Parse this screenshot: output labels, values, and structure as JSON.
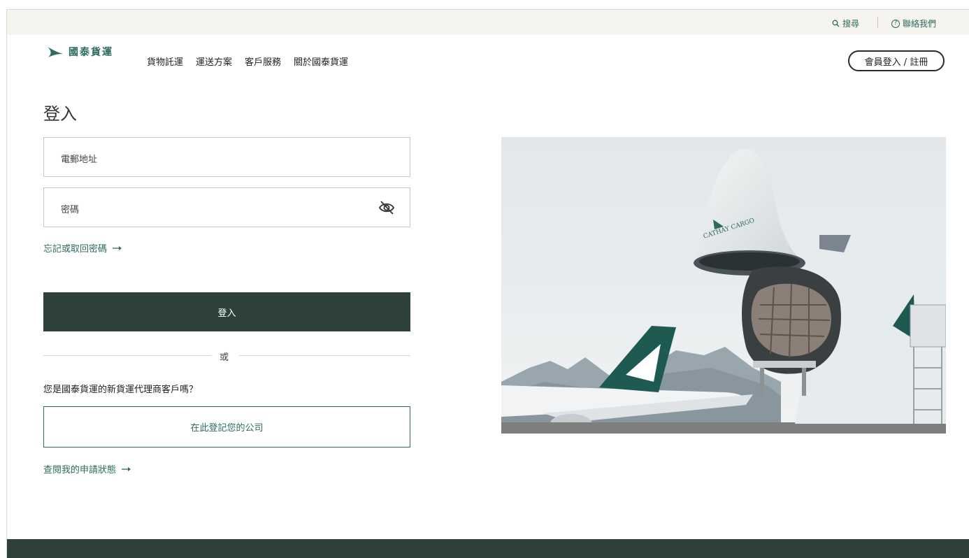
{
  "utility": {
    "search_label": "搜尋",
    "contact_label": "聯絡我們"
  },
  "header": {
    "logo_text": "國泰貨運",
    "nav": [
      {
        "label": "貨物託運"
      },
      {
        "label": "運送方案"
      },
      {
        "label": "客戶服務"
      },
      {
        "label": "關於國泰貨運"
      }
    ],
    "login_register_label": "會員登入 / 註冊"
  },
  "login": {
    "title": "登入",
    "email_placeholder": "電郵地址",
    "password_placeholder": "密碼",
    "forgot_link": "忘記或取回密碼",
    "submit_label": "登入",
    "divider_text": "或",
    "agent_question": "您是國泰貨運的新貨運代理商客戶嗎？",
    "register_label": "在此登記您的公司",
    "status_link": "查閱我的申請狀態"
  },
  "hero": {
    "aircraft_text": "CATHAY CARGO"
  },
  "colors": {
    "brand_green": "#2d6b62",
    "dark_green": "#2e4138",
    "utility_bg": "#f6f4ee"
  },
  "icons": [
    "search-icon",
    "help-circle-icon",
    "eye-slash-icon",
    "arrow-right-icon",
    "brushwing-logo-icon"
  ]
}
